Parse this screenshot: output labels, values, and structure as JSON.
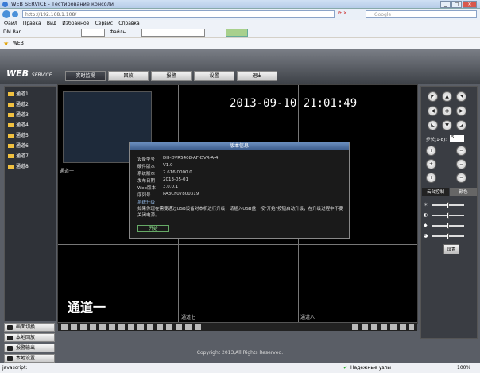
{
  "browser": {
    "title": "WEB SERVICE - Тестирование консоли",
    "address": "http://192.168.1.108/",
    "search_placeholder": "Google",
    "menu": [
      "Файл",
      "Правка",
      "Вид",
      "Избранное",
      "Сервис",
      "Справка"
    ],
    "toolbar_items": [
      "DM Bar",
      "Файлы"
    ],
    "fav_tab": "WEB",
    "status_text": "javascript:",
    "status_zone": "Надежные узлы",
    "zoom": "100%"
  },
  "app": {
    "logo": "WEB",
    "logo_sub": "SERVICE",
    "tabs": [
      "实时监视",
      "回放",
      "报警",
      "设置",
      "退出"
    ],
    "channels": [
      "通道1",
      "通道2",
      "通道3",
      "通道4",
      "通道5",
      "通道6",
      "通道7",
      "通道8"
    ],
    "left_buttons": [
      "画面切换",
      "本地回放",
      "报警输出",
      "本地设置"
    ],
    "copyright": "Copyright 2013,All Rights Reserved."
  },
  "video": {
    "timestamp": "2013-09-10 21:01:49",
    "channel_overlay": "通道一",
    "cell_labels": [
      "通道一",
      "通道七",
      "通道八"
    ]
  },
  "dialog": {
    "title": "版本信息",
    "rows": [
      {
        "label": "设备型号",
        "value": "DH-DVR5408-AF-DVR-A-4"
      },
      {
        "label": "硬件版本",
        "value": "V1.0"
      },
      {
        "label": "系统版本",
        "value": "2.616.0000.0"
      },
      {
        "label": "发布日期",
        "value": "2013-05-01"
      },
      {
        "label": "Web版本",
        "value": "3.0.0.1"
      },
      {
        "label": "序列号",
        "value": "PA3CF07800319"
      }
    ],
    "section": "系统升级",
    "note": "如果你现在需要通过USB设备对本机进行升级，请插入USB盘，按\"开始\"按钮启动升级，在升级过程中不要关闭电源。",
    "start_label": "开始"
  },
  "ptz": {
    "step_label": "步长(1-8):",
    "step_value": "5",
    "tabs": [
      "云台控制",
      "颜色"
    ],
    "set_label": "设置"
  }
}
